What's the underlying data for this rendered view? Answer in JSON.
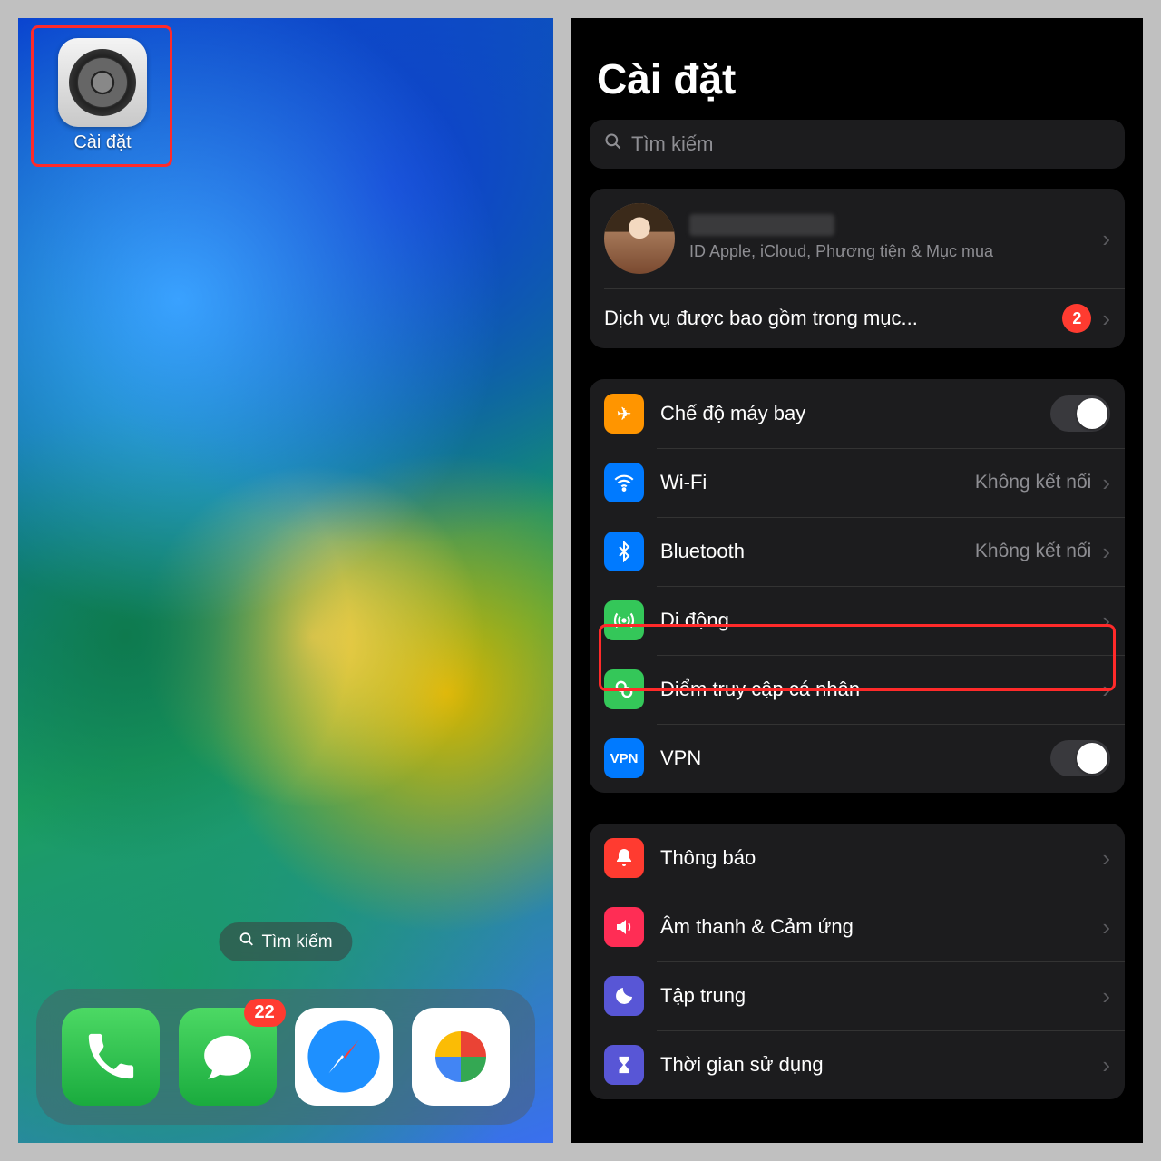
{
  "home": {
    "app_label": "Cài đặt",
    "search_pill": "Tìm kiếm",
    "messages_badge": "22"
  },
  "settings": {
    "title": "Cài đặt",
    "search_placeholder": "Tìm kiếm",
    "profile_sub": "ID Apple, iCloud, Phương tiện & Mục mua",
    "subscription_row": "Dịch vụ được bao gồm trong mục...",
    "subscription_badge": "2",
    "rows": {
      "airplane": "Chế độ máy bay",
      "wifi": "Wi-Fi",
      "wifi_status": "Không kết nối",
      "bluetooth": "Bluetooth",
      "bluetooth_status": "Không kết nối",
      "cellular": "Di động",
      "hotspot": "Điểm truy cập cá nhân",
      "vpn": "VPN",
      "notifications": "Thông báo",
      "sounds": "Âm thanh & Cảm ứng",
      "focus": "Tập trung",
      "screentime": "Thời gian sử dụng"
    }
  }
}
